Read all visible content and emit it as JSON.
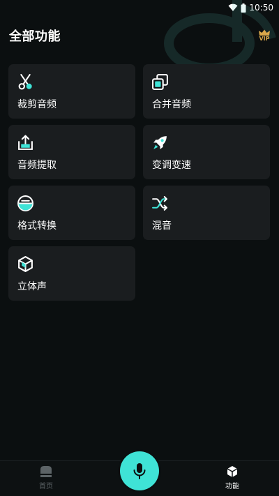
{
  "status_bar": {
    "time": "10:50"
  },
  "header": {
    "title": "全部功能",
    "vip_label": "VIP"
  },
  "features": [
    {
      "label": "裁剪音频",
      "icon": "scissors-icon"
    },
    {
      "label": "合并音频",
      "icon": "merge-icon"
    },
    {
      "label": "音频提取",
      "icon": "upload-tray-icon"
    },
    {
      "label": "变调变速",
      "icon": "rocket-icon"
    },
    {
      "label": "格式转换",
      "icon": "format-convert-icon"
    },
    {
      "label": "混音",
      "icon": "shuffle-icon"
    },
    {
      "label": "立体声",
      "icon": "cube-icon"
    }
  ],
  "bottom_nav": {
    "home_label": "首页",
    "features_label": "功能",
    "active_tab": "功能"
  },
  "colors": {
    "accent": "#3fe3d6",
    "card_bg": "#1a1d1f",
    "page_bg": "#0b0f10",
    "vip_gold": "#d9a74a"
  }
}
